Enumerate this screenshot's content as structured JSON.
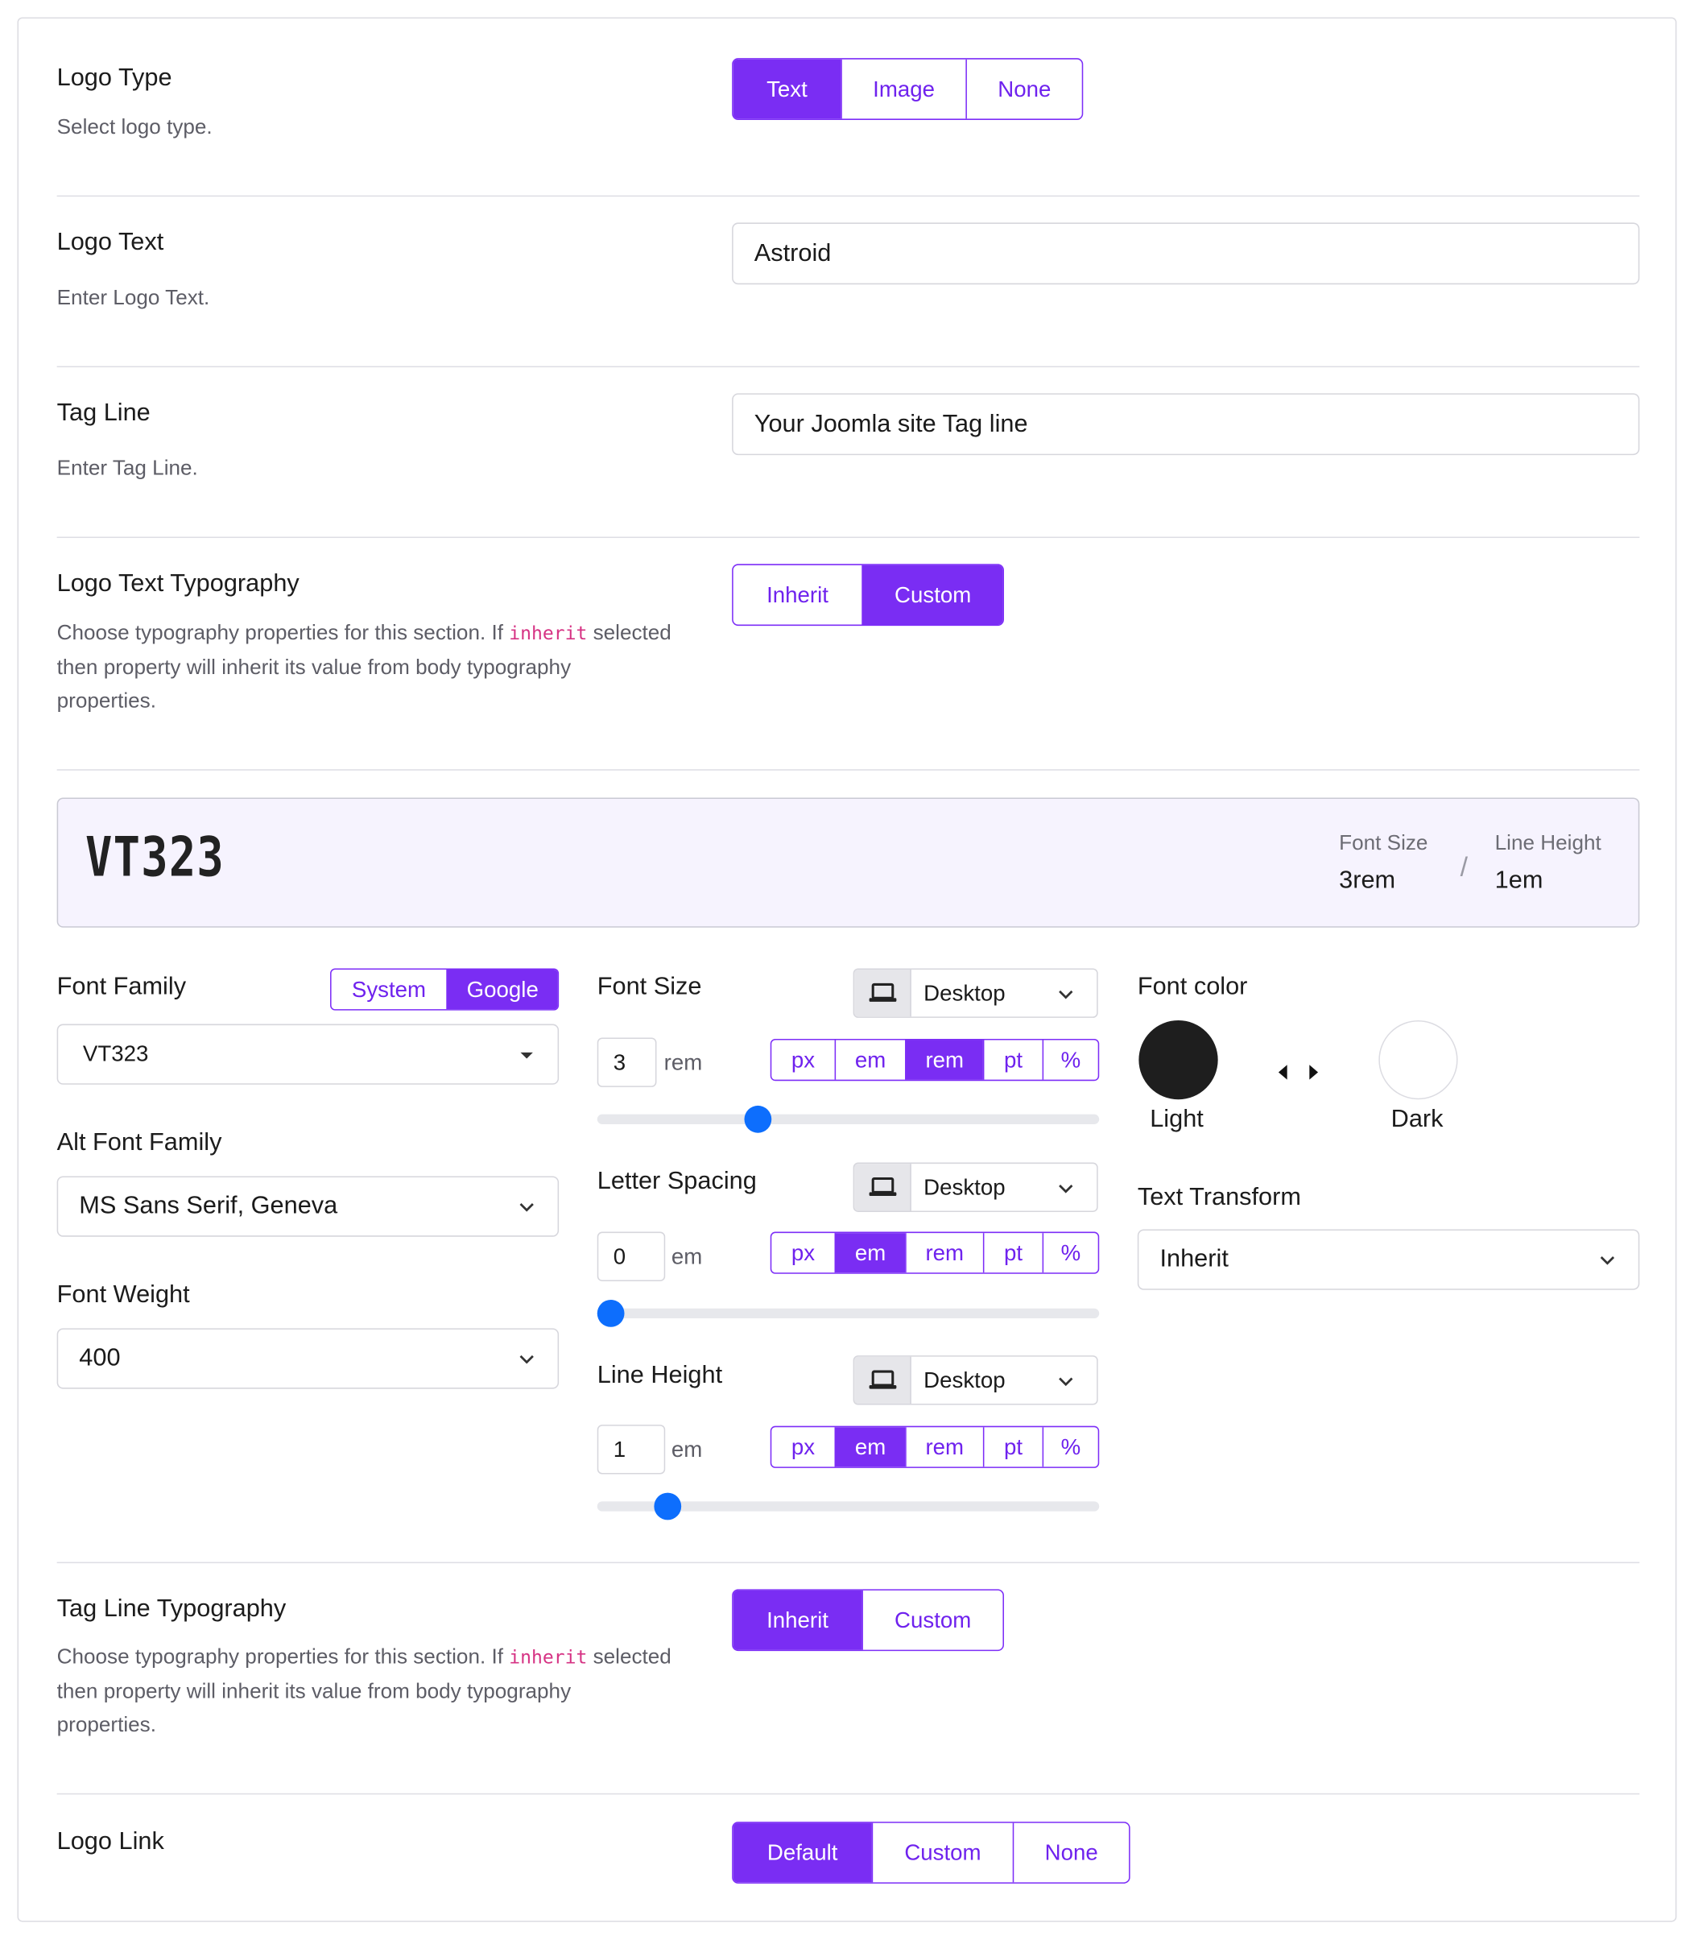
{
  "logo_type": {
    "label": "Logo Type",
    "desc": "Select logo type.",
    "options": [
      "Text",
      "Image",
      "None"
    ],
    "active": 0
  },
  "logo_text": {
    "label": "Logo Text",
    "desc": "Enter Logo Text.",
    "value": "Astroid"
  },
  "tag_line": {
    "label": "Tag Line",
    "desc": "Enter Tag Line.",
    "value": "Your Joomla site Tag line"
  },
  "logo_typography": {
    "label": "Logo Text Typography",
    "desc_before": "Choose typography properties for this section. If ",
    "desc_code": "inherit",
    "desc_after": " selected then property will inherit its value from body typography properties.",
    "options": [
      "Inherit",
      "Custom"
    ],
    "active": 1
  },
  "preview": {
    "font_name": "VT323",
    "font_size_label": "Font Size",
    "font_size_value": "3rem",
    "separator": "/",
    "line_height_label": "Line Height",
    "line_height_value": "1em"
  },
  "font_family": {
    "label": "Font Family",
    "source_options": [
      "System",
      "Google"
    ],
    "source_active": 1,
    "value": "VT323"
  },
  "alt_font_family": {
    "label": "Alt Font Family",
    "value": "MS Sans Serif, Geneva"
  },
  "font_weight": {
    "label": "Font Weight",
    "value": "400"
  },
  "font_size": {
    "label": "Font Size",
    "device": "Desktop",
    "value": "3",
    "unit": "rem",
    "units": [
      "px",
      "em",
      "rem",
      "pt",
      "%"
    ],
    "active_unit": 2,
    "slider_fraction": 0.31
  },
  "letter_spacing": {
    "label": "Letter Spacing",
    "device": "Desktop",
    "value": "0",
    "unit": "em",
    "units": [
      "px",
      "em",
      "rem",
      "pt",
      "%"
    ],
    "active_unit": 1,
    "slider_fraction": 0.0
  },
  "line_height": {
    "label": "Line Height",
    "device": "Desktop",
    "value": "1",
    "unit": "em",
    "units": [
      "px",
      "em",
      "rem",
      "pt",
      "%"
    ],
    "active_unit": 1,
    "slider_fraction": 0.12
  },
  "font_color": {
    "label": "Font color",
    "light_label": "Light",
    "dark_label": "Dark",
    "light_color": "#1e1e1e",
    "dark_color": "#ffffff"
  },
  "text_transform": {
    "label": "Text Transform",
    "value": "Inherit"
  },
  "tagline_typography": {
    "label": "Tag Line Typography",
    "desc_before": "Choose typography properties for this section. If ",
    "desc_code": "inherit",
    "desc_after": " selected then property will inherit its value from body typography properties.",
    "options": [
      "Inherit",
      "Custom"
    ],
    "active": 0
  },
  "logo_link": {
    "label": "Logo Link",
    "options": [
      "Default",
      "Custom",
      "None"
    ],
    "active": 0
  },
  "colors": {
    "accent": "#7a2df3",
    "slider_thumb": "#0d6efd",
    "code": "#d63384"
  },
  "icons": {
    "device": "laptop-icon",
    "dropdown": "chevron-down-icon",
    "caret": "caret-down-icon",
    "swap": "swap-arrows-icon"
  }
}
